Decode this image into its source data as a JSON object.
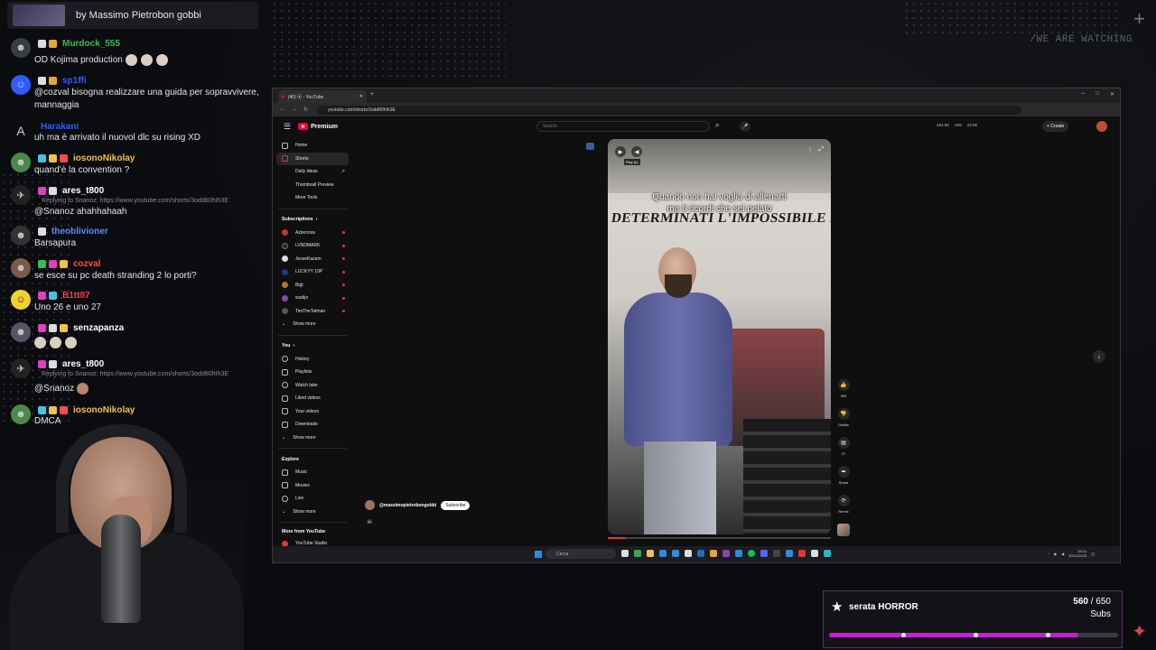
{
  "overlay": {
    "watermark": "/WE ARE WATCHING",
    "now_showing": "by Massimo Pietrobon gobbi"
  },
  "chat": {
    "messages": [
      {
        "user": "Murdock_555",
        "user_color": "#3fb950",
        "text": "OD Kojima production",
        "emoji_count": 3
      },
      {
        "user": "sp1ffi",
        "user_color": "#2f5bff",
        "text": "@cozval bisogna realizzare una guida per sopravvivere, mannaggia"
      },
      {
        "user": "Harakani",
        "user_color": "#2f5bff",
        "text": "uh ma è arrivato il nuovol dlc su rising XD"
      },
      {
        "user": "iosonoNikolay",
        "user_color": "#f2c14e",
        "text": "quand'è la convention ?"
      },
      {
        "user": "ares_t800",
        "user_color": "#ffffff",
        "reply": "Replying to Snanoz: https://www.youtube.com/shorts/3odd80hIh3E",
        "text": "@Snanoz ahahhahaah"
      },
      {
        "user": "theoblivioner",
        "user_color": "#5b8cff",
        "text": "Barsapura"
      },
      {
        "user": "cozval",
        "user_color": "#ff4d4d",
        "text": "se esce su pc death stranding 2 lo porti?"
      },
      {
        "user": "B1tt87",
        "user_color": "#ff3355",
        "text": "Uno 26 e uno 27"
      },
      {
        "user": "senzapanza",
        "user_color": "#ffffff",
        "text": "",
        "emoji_count": 3
      },
      {
        "user": "ares_t800",
        "user_color": "#ffffff",
        "reply": "Replying to Snanoz: https://www.youtube.com/shorts/3odd80hIh3E",
        "text": "@Snanoz"
      },
      {
        "user": "iosonoNikolay",
        "user_color": "#f2c14e",
        "text": "DMCA"
      }
    ]
  },
  "browser": {
    "tab_title": "(40) ⦿ - YouTube",
    "url": "youtube.com/shorts/3odd80hIh3E",
    "youtube": {
      "logo": "Premium",
      "search_placeholder": "Search",
      "stats": [
        "294.9K",
        "949",
        "23.9K"
      ],
      "create_label": "+ Create",
      "sidebar": {
        "main": [
          {
            "label": "Home",
            "active": false
          },
          {
            "label": "Shorts",
            "active": true
          },
          {
            "label": "Daily Ideas",
            "active": false
          },
          {
            "label": "Thumbnail Preview",
            "active": false
          },
          {
            "label": "More Tools",
            "active": false
          }
        ],
        "subscriptions_title": "Subscriptions",
        "subscriptions": [
          {
            "label": "Aztecross",
            "color": "#c0392b"
          },
          {
            "label": "LVNDMARK",
            "color": "#222222"
          },
          {
            "label": "JesseKazam",
            "color": "#dddddd"
          },
          {
            "label": "LUCKYY 10P",
            "color": "#1e3a8a"
          },
          {
            "label": "Bigt",
            "color": "#b8732e"
          },
          {
            "label": "wudijo",
            "color": "#8e44ad"
          },
          {
            "label": "TimTheTatman",
            "color": "#555555"
          }
        ],
        "show_more": "Show more",
        "you_title": "You",
        "you": [
          "History",
          "Playlists",
          "Watch later",
          "Liked videos",
          "Your videos",
          "Downloads"
        ],
        "explore_title": "Explore",
        "explore": [
          "Music",
          "Movies",
          "Live"
        ],
        "more_title": "More from YouTube",
        "more": [
          "YouTube Studio"
        ]
      },
      "short": {
        "caption_line1": "Quando non hai voglia di allenarti",
        "caption_line2": "ma ti ricordi che sei pelato",
        "wall_text": "DETERMINATI L'IMPOSSIBILE NON ESISTE",
        "tooltip": "Play (k)",
        "channel": "@massimopietrobongobbi",
        "subscribe_label": "Subscribe",
        "progress": 0.08
      },
      "actions": [
        {
          "label": "965",
          "icon": "like-icon"
        },
        {
          "label": "Dislike",
          "icon": "dislike-icon"
        },
        {
          "label": "27",
          "icon": "comment-icon"
        },
        {
          "label": "Share",
          "icon": "share-icon"
        },
        {
          "label": "Remix",
          "icon": "remix-icon"
        }
      ]
    },
    "taskbar": {
      "search_label": "Cerca",
      "time": "18:14",
      "date": "30/12/2025"
    }
  },
  "goal": {
    "title": "serata HORROR",
    "current": "560",
    "target": "650",
    "separator": " / ",
    "unit": "Subs",
    "progress": 0.862,
    "accent": "#c21fd6"
  }
}
